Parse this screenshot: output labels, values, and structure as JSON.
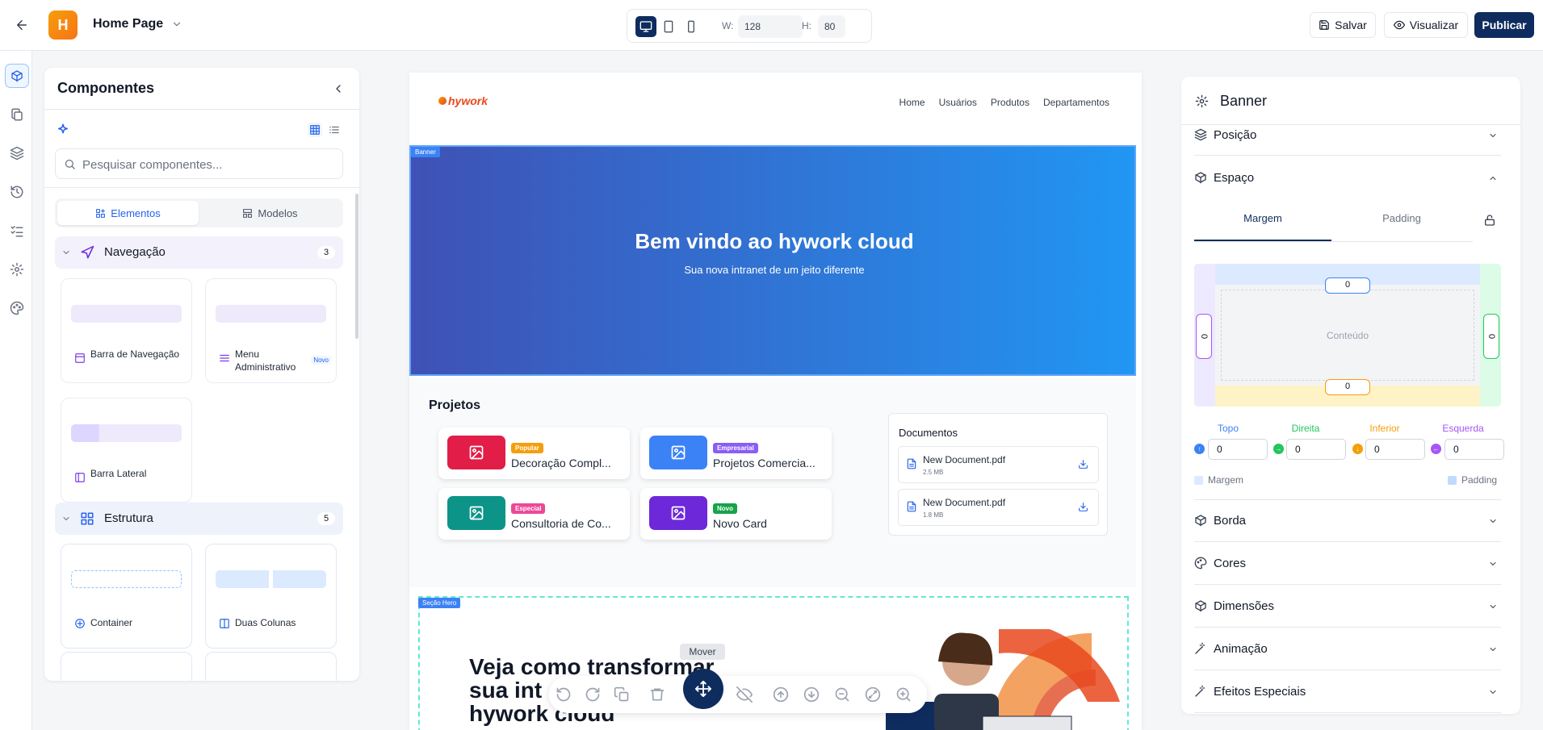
{
  "topbar": {
    "logo_letter": "H",
    "page_name": "Home Page",
    "width_label": "W:",
    "width_value": "128",
    "height_label": "H:",
    "height_value": "80",
    "save_label": "Salvar",
    "preview_label": "Visualizar",
    "publish_label": "Publicar"
  },
  "components": {
    "title": "Componentes",
    "search_placeholder": "Pesquisar componentes...",
    "tab_elements": "Elementos",
    "tab_models": "Modelos",
    "categories": [
      {
        "label": "Navegação",
        "count": "3"
      },
      {
        "label": "Estrutura",
        "count": "5"
      }
    ],
    "items": [
      {
        "label": "Barra de Navegação"
      },
      {
        "label": "Menu Administrativo",
        "badge": "Novo"
      },
      {
        "label": "Barra Lateral"
      },
      {
        "label": "Container"
      },
      {
        "label": "Duas Colunas"
      }
    ]
  },
  "canvas": {
    "logo_text": "hywork",
    "nav": [
      "Home",
      "Usuários",
      "Produtos",
      "Departamentos"
    ],
    "banner_tag": "Banner",
    "banner_title": "Bem vindo ao hywork cloud",
    "banner_subtitle": "Sua nova intranet de um jeito diferente",
    "projects_title": "Projetos",
    "projects": [
      {
        "badge": "Popular",
        "name": "Decoração Compl...",
        "color": "#e11d48",
        "badge_color": "#f59e0b"
      },
      {
        "badge": "Empresarial",
        "name": "Projetos Comercia...",
        "color": "#3b82f6",
        "badge_color": "#8b5cf6"
      },
      {
        "badge": "Especial",
        "name": "Consultoria de Co...",
        "color": "#0d9488",
        "badge_color": "#ec4899"
      },
      {
        "badge": "Novo",
        "name": "Novo Card",
        "color": "#6d28d9",
        "badge_color": "#16a34a"
      }
    ],
    "documents_title": "Documentos",
    "documents": [
      {
        "name": "New Document.pdf",
        "size": "2.5 MB"
      },
      {
        "name": "New Document.pdf",
        "size": "1.8 MB"
      }
    ],
    "hero_tag": "Seção Hero",
    "hero_title_lines": [
      "Veja como transformar",
      "sua int",
      "hywork cloud"
    ],
    "move_tooltip": "Mover"
  },
  "props": {
    "title": "Banner",
    "sections_top": [
      {
        "label": "Posição",
        "icon": "layers-icon"
      },
      {
        "label": "Espaço",
        "icon": "box-icon"
      }
    ],
    "tab_margin": "Margem",
    "tab_padding": "Padding",
    "box_top": "0",
    "box_bottom": "0",
    "box_left": "0",
    "box_right": "0",
    "content_label": "Conteúdo",
    "fields": [
      {
        "label": "Topo",
        "value": "0",
        "color": "#3b82f6"
      },
      {
        "label": "Direita",
        "value": "0",
        "color": "#22c55e"
      },
      {
        "label": "Inferior",
        "value": "0",
        "color": "#f59e0b"
      },
      {
        "label": "Esquerda",
        "value": "0",
        "color": "#a855f7"
      }
    ],
    "legend_margin": "Margem",
    "legend_padding": "Padding",
    "sections": [
      {
        "label": "Borda",
        "icon": "box-icon"
      },
      {
        "label": "Cores",
        "icon": "palette-icon"
      },
      {
        "label": "Dimensões",
        "icon": "box-icon"
      },
      {
        "label": "Animação",
        "icon": "wand-icon"
      },
      {
        "label": "Efeitos Especiais",
        "icon": "wand-icon"
      }
    ]
  }
}
